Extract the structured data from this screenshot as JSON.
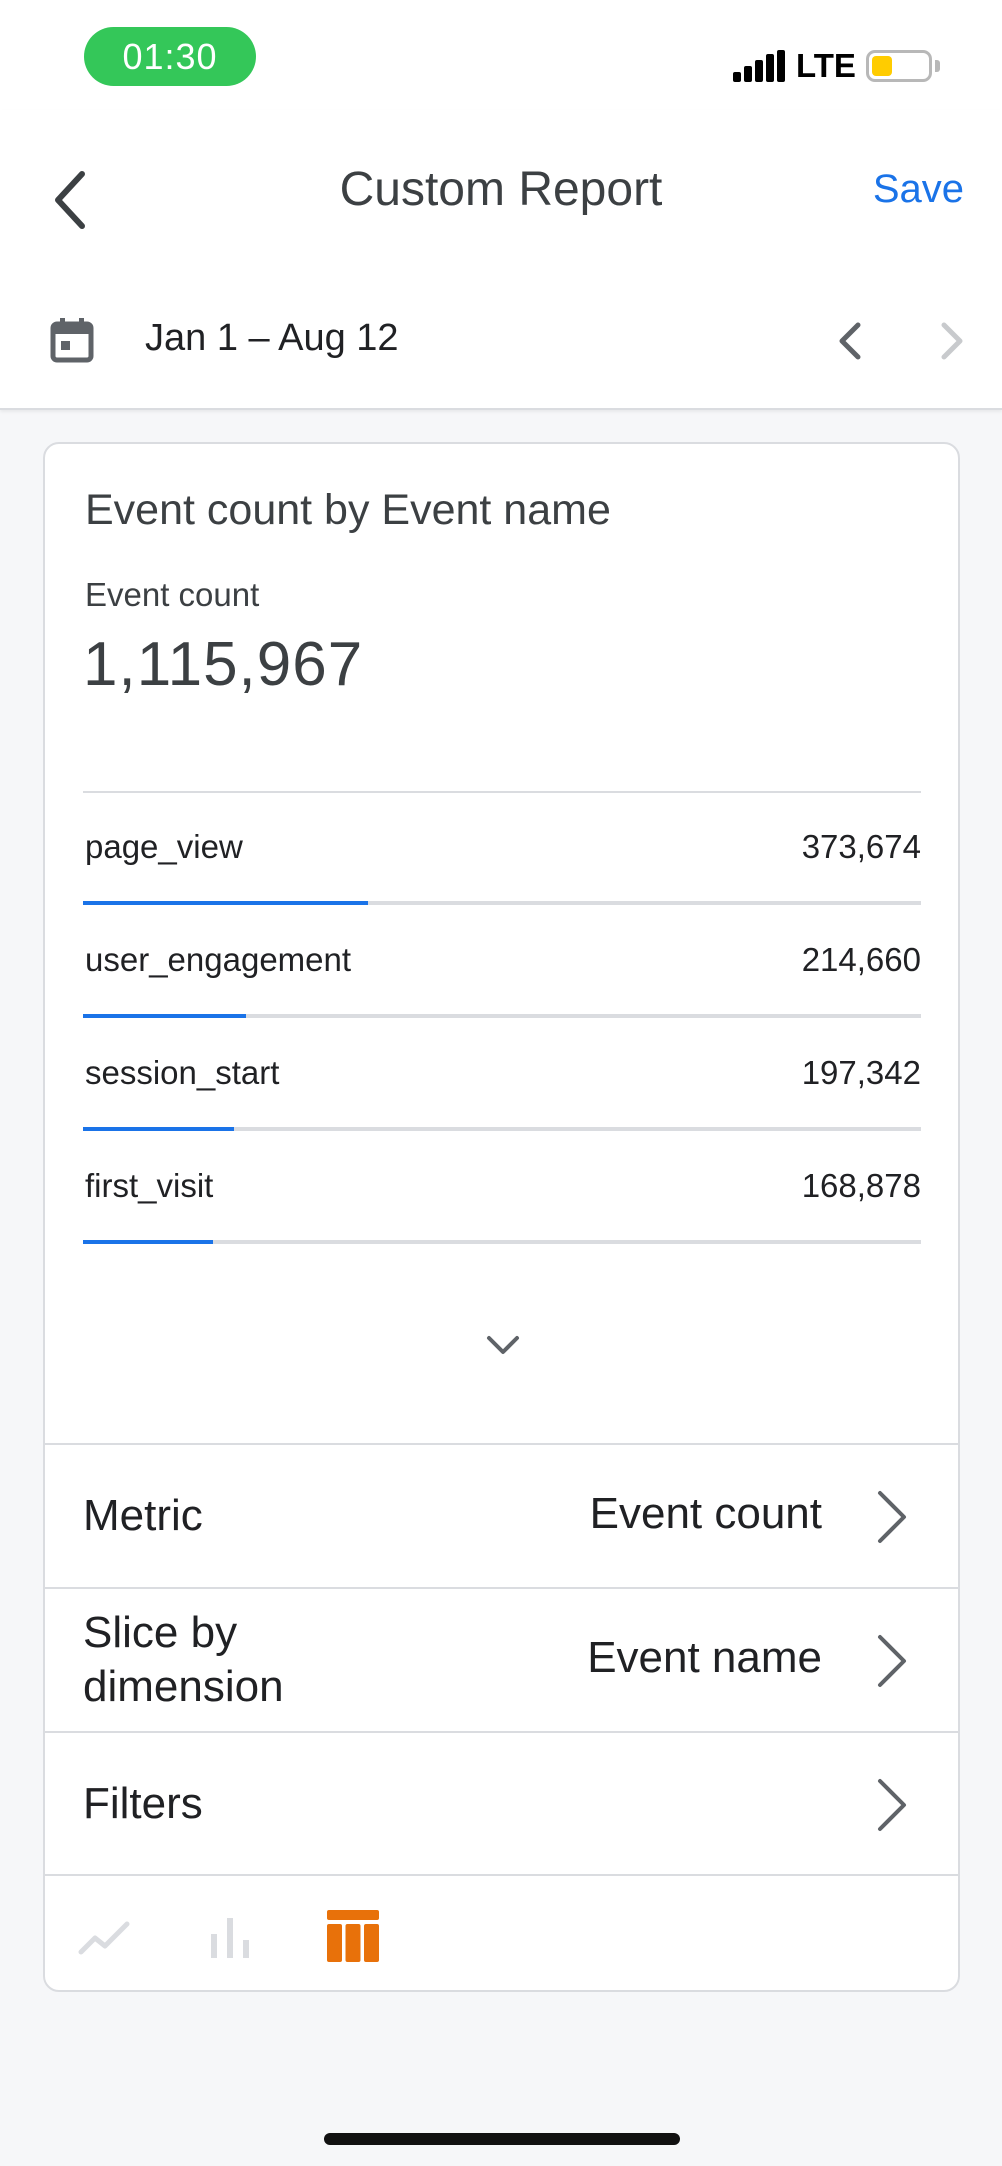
{
  "status_bar": {
    "time": "01:30",
    "network": "LTE",
    "battery_color": "#ffcc00"
  },
  "header": {
    "title": "Custom Report",
    "save_label": "Save",
    "date_range": "Jan 1 – Aug 12"
  },
  "card": {
    "title": "Event count by Event name",
    "metric_label": "Event count",
    "metric_value": "1,115,967",
    "rows": [
      {
        "name": "page_view",
        "value": "373,674",
        "share": 0.34
      },
      {
        "name": "user_engagement",
        "value": "214,660",
        "share": 0.195
      },
      {
        "name": "session_start",
        "value": "197,342",
        "share": 0.18
      },
      {
        "name": "first_visit",
        "value": "168,878",
        "share": 0.155
      }
    ],
    "settings": {
      "metric": {
        "label": "Metric",
        "value": "Event count"
      },
      "dimension": {
        "label_line1": "Slice by",
        "label_line2": "dimension",
        "value": "Event name"
      },
      "filters": {
        "label": "Filters"
      }
    },
    "viz_types": [
      {
        "icon": "line-chart-icon",
        "active": false
      },
      {
        "icon": "bar-chart-icon",
        "active": false
      },
      {
        "icon": "table-icon",
        "active": true
      }
    ]
  },
  "colors": {
    "accent": "#1a73e8",
    "active_viz": "#e8710a",
    "inactive_viz": "#dadce0"
  }
}
